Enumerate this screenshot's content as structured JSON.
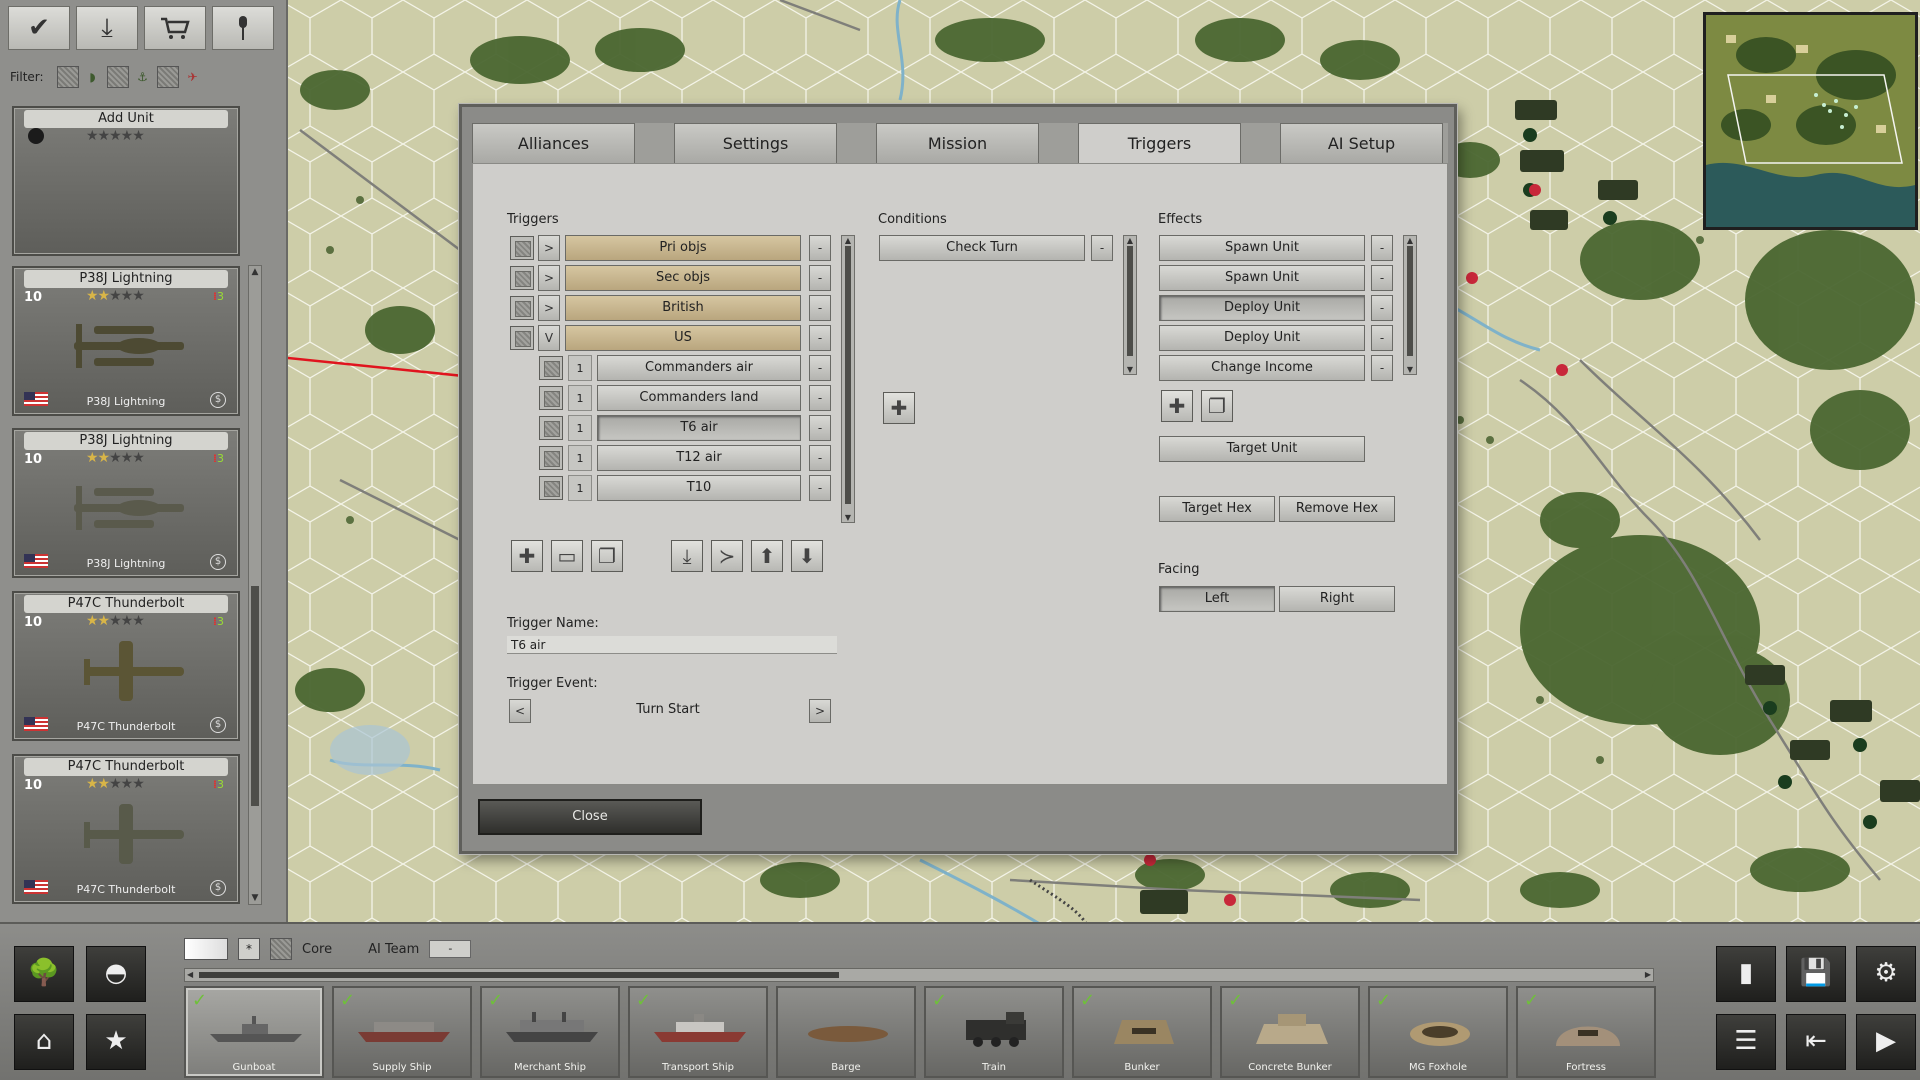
{
  "left_panel": {
    "filter_label": "Filter:",
    "toolbar_icons": [
      "check-icon",
      "download-icon",
      "cart-icon",
      "pin-icon"
    ],
    "units": [
      {
        "title": "Add Unit",
        "strength": "",
        "stars_gold": 0
      },
      {
        "title": "P38J Lightning",
        "strength": "10",
        "stars_gold": 2,
        "ammo": "3",
        "name": "P38J Lightning",
        "exp_icon": "$"
      },
      {
        "title": "P38J Lightning",
        "strength": "10",
        "stars_gold": 2,
        "ammo": "3",
        "name": "P38J Lightning",
        "exp_icon": "$"
      },
      {
        "title": "P47C Thunderbolt",
        "strength": "10",
        "stars_gold": 2,
        "ammo": "3",
        "name": "P47C Thunderbolt",
        "exp_icon": "$"
      },
      {
        "title": "P47C Thunderbolt",
        "strength": "10",
        "stars_gold": 2,
        "ammo": "3",
        "name": "P47C Thunderbolt",
        "exp_icon": "$"
      }
    ]
  },
  "dialog": {
    "tabs": [
      "Alliances",
      "Settings",
      "Mission",
      "Triggers",
      "AI Setup"
    ],
    "active_tab": "Triggers",
    "triggers_label": "Triggers",
    "conditions_label": "Conditions",
    "effects_label": "Effects",
    "expand_symbols": [
      ">",
      ">",
      ">",
      "V"
    ],
    "minus_symbol": "-",
    "trigger_groups": [
      "Pri objs",
      "Sec objs",
      "British",
      "US"
    ],
    "sub_triggers": [
      {
        "num": "1",
        "label": "Commanders air"
      },
      {
        "num": "1",
        "label": "Commanders land"
      },
      {
        "num": "1",
        "label": "T6 air"
      },
      {
        "num": "1",
        "label": "T12 air"
      },
      {
        "num": "1",
        "label": "T10"
      }
    ],
    "conditions": [
      "Check Turn"
    ],
    "effects": [
      "Spawn Unit",
      "Spawn Unit",
      "Deploy Unit",
      "Deploy Unit",
      "Change Income"
    ],
    "target_unit": "Target Unit",
    "target_hex": "Target Hex",
    "remove_hex": "Remove Hex",
    "facing_label": "Facing",
    "facing_left": "Left",
    "facing_right": "Right",
    "trigger_name_label": "Trigger Name:",
    "trigger_name_value": "T6 air",
    "trigger_event_label": "Trigger Event:",
    "trigger_event_value": "Turn Start",
    "prev_symbol": "<",
    "next_symbol": ">",
    "close_label": "Close"
  },
  "bottom_bar": {
    "core_label": "Core",
    "ai_team_label": "AI Team",
    "ai_team_value": "-",
    "slots": [
      "Gunboat",
      "Supply Ship",
      "Merchant Ship",
      "Transport Ship",
      "Barge",
      "Train",
      "Bunker",
      "Concrete Bunker",
      "MG Foxhole",
      "Fortress"
    ]
  },
  "colors": {
    "arrow": "#e0141e",
    "trigger_tan": "#c9b68e",
    "map_grass": "#cfcfa9",
    "forest": "#46612c"
  }
}
